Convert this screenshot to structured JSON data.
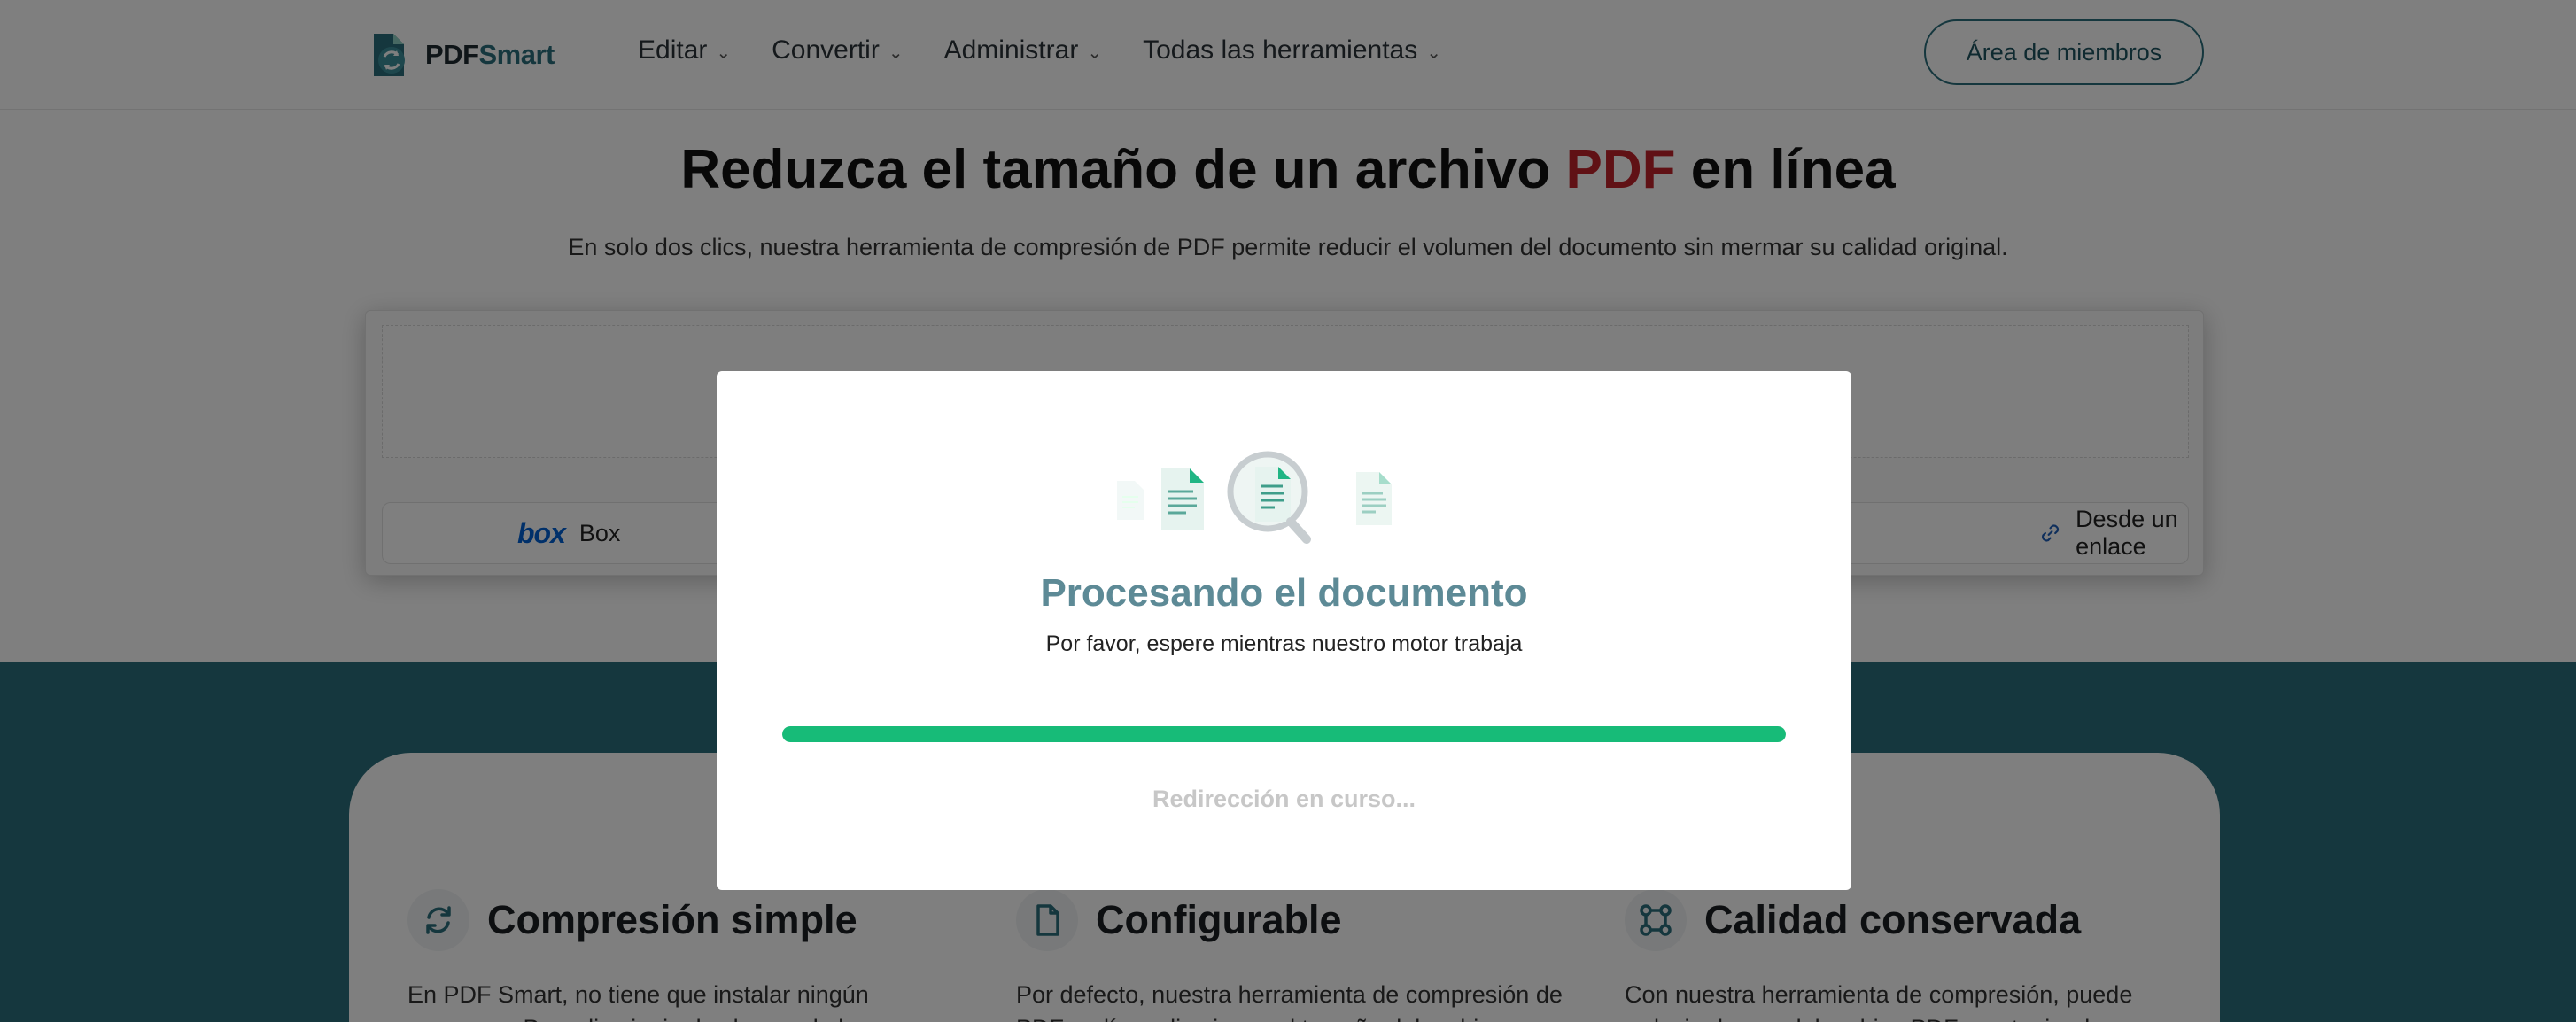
{
  "header": {
    "logo": {
      "prefix": "PDF",
      "accent": "Smart"
    },
    "nav": [
      {
        "label": "Editar"
      },
      {
        "label": "Convertir"
      },
      {
        "label": "Administrar"
      },
      {
        "label": "Todas las herramientas"
      }
    ],
    "members_label": "Área de miembros"
  },
  "hero": {
    "title_before": "Reduzca el tamaño de un archivo ",
    "title_highlight": "PDF",
    "title_after": " en línea",
    "subtitle": "En solo dos clics, nuestra herramienta de compresión de PDF permite reducir el volumen del documento sin mermar su calidad original."
  },
  "upload": {
    "sources": [
      {
        "label": "Box",
        "icon": "box-logo-icon"
      },
      {
        "label": "Desde un enlace",
        "icon": "link-icon"
      }
    ]
  },
  "features": [
    {
      "title": "Compresión simple",
      "icon": "refresh-icon",
      "text": "En PDF Smart, no tiene que instalar ningún programa. Para disminuir el volumen de los"
    },
    {
      "title": "Configurable",
      "icon": "document-icon",
      "text": "Por defecto, nuestra herramienta de compresión de PDF en línea disminuye el tamaño del archivo un"
    },
    {
      "title": "Calidad conservada",
      "icon": "nodes-icon",
      "text": "Con nuestra herramienta de compresión, puede reducir el peso del archivo PDF manteniendo su"
    }
  ],
  "modal": {
    "title": "Procesando el documento",
    "subtitle": "Por favor, espere mientras nuestro motor trabaja",
    "progress": 1.0,
    "status": "Redirección en curso..."
  },
  "colors": {
    "brand": "#2b6f7c",
    "highlight_red": "#c0232b",
    "progress": "#17bb78",
    "modal_title": "#5d8a96"
  }
}
